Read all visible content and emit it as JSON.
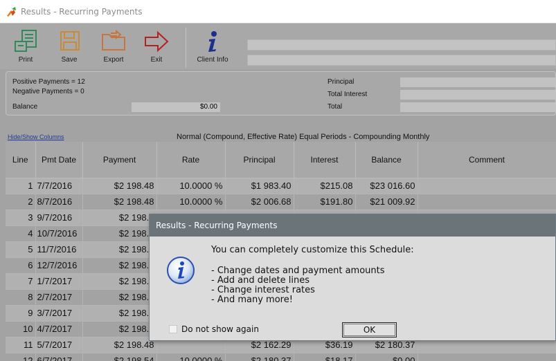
{
  "window": {
    "title": "Results - Recurring Payments"
  },
  "toolbar": {
    "buttons": [
      {
        "label": "Print",
        "icon": "printer-icon"
      },
      {
        "label": "Save",
        "icon": "save-icon"
      },
      {
        "label": "Export",
        "icon": "export-folder-icon"
      },
      {
        "label": "Exit",
        "icon": "exit-arrow-icon"
      },
      {
        "label": "Client Info",
        "icon": "info-i-icon"
      }
    ]
  },
  "summary": {
    "positive_payments": "Positive Payments = 12",
    "negative_payments": "Negative Payments = 0",
    "balance_label": "Balance",
    "balance_value": "$0.00",
    "principal_label": "Principal",
    "total_interest_label": "Total Interest",
    "total_label": "Total"
  },
  "hide_show_columns": "Hide/Show Columns",
  "schedule_caption": "Normal (Compound, Effective Rate) Equal Periods - Compounding Monthly",
  "columns": [
    "Line",
    "Pmt Date",
    "Payment",
    "Rate",
    "Principal",
    "Interest",
    "Balance",
    "Comment"
  ],
  "rows": [
    [
      "1",
      "7/7/2016",
      "$2 198.48",
      "10.0000 %",
      "$1 983.40",
      "$215.08",
      "$23 016.60",
      ""
    ],
    [
      "2",
      "8/7/2016",
      "$2 198.48",
      "10.0000 %",
      "$2 006.68",
      "$191.80",
      "$21 009.92",
      ""
    ],
    [
      "3",
      "9/7/2016",
      "$2 198.4",
      "",
      "",
      "",
      "",
      ""
    ],
    [
      "4",
      "10/7/2016",
      "$2 198.4",
      "",
      "",
      "",
      "",
      ""
    ],
    [
      "5",
      "11/7/2016",
      "$2 198.4",
      "",
      "",
      "",
      "",
      ""
    ],
    [
      "6",
      "12/7/2016",
      "$2 198.4",
      "",
      "",
      "",
      "",
      ""
    ],
    [
      "7",
      "1/7/2017",
      "$2 198.4",
      "",
      "",
      "",
      "",
      ""
    ],
    [
      "8",
      "2/7/2017",
      "$2 198.4",
      "",
      "",
      "",
      "",
      ""
    ],
    [
      "9",
      "3/7/2017",
      "$2 198.4",
      "",
      "",
      "",
      "",
      ""
    ],
    [
      "10",
      "4/7/2017",
      "$2 198.4",
      "",
      "",
      "",
      "",
      ""
    ],
    [
      "11",
      "5/7/2017",
      "$2 198.48",
      "",
      "$2 162.29",
      "$36.19",
      "$2 180.37",
      ""
    ],
    [
      "12",
      "6/7/2017",
      "$2 198.54",
      "10.0000 %",
      "$2 180.37",
      "$18.17",
      "$0.00",
      ""
    ]
  ],
  "dialog": {
    "title": "Results - Recurring Payments",
    "icon": "info-icon",
    "message": "You can completely customize this Schedule:",
    "items": [
      "- Change dates and payment amounts",
      "- Add and delete lines",
      "- Change interest rates",
      "- And many more!"
    ],
    "checkbox_label": "Do not show again",
    "ok_label": "OK"
  },
  "colors": {
    "dialog_titlebar": "#6b7579",
    "print_icon": "#2e8b57",
    "save_icon": "#c98a3a",
    "export_icon": "#c8743a",
    "exit_icon": "#b52020",
    "info_icon": "#1d2f8a"
  }
}
